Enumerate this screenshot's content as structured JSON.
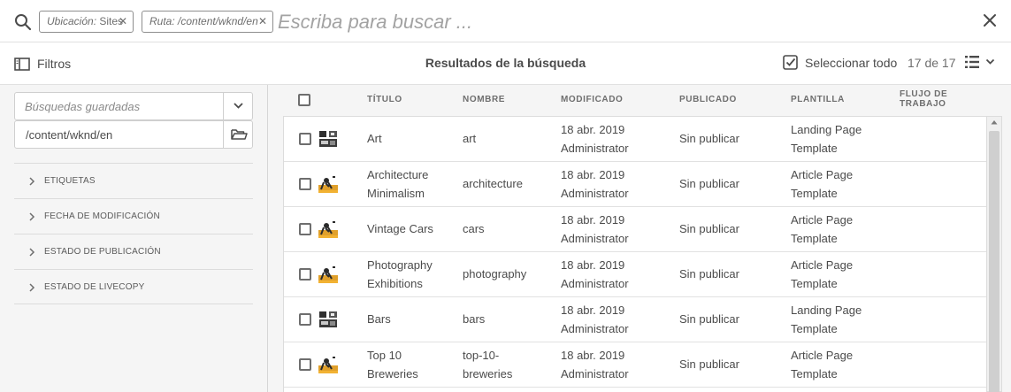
{
  "search": {
    "tags": [
      {
        "key": "Ubicación:",
        "value": " Sites"
      },
      {
        "key": "Ruta:",
        "value": " /content/wknd/en"
      }
    ],
    "placeholder": "Escriba para buscar ..."
  },
  "actionbar": {
    "filters_label": "Filtros",
    "title": "Resultados de la búsqueda",
    "select_all_label": "Seleccionar todo",
    "count": "17 de 17"
  },
  "rail": {
    "saved_searches_placeholder": "Búsquedas guardadas",
    "path_value": "/content/wknd/en",
    "sections": [
      "ETIQUETAS",
      "FECHA DE MODIFICACIÓN",
      "ESTADO DE PUBLICACIÓN",
      "ESTADO DE LIVECOPY"
    ]
  },
  "table": {
    "headers": {
      "title": "TÍTULO",
      "name": "NOMBRE",
      "modified": "MODIFICADO",
      "published": "PUBLICADO",
      "template": "PLANTILLA",
      "workflow_1": "FLUJO DE",
      "workflow_2": "TRABAJO"
    },
    "rows": [
      {
        "title_1": "Art",
        "title_2": "",
        "name_1": "art",
        "name_2": "",
        "date": "18 abr. 2019",
        "user": "Administrator",
        "published": "Sin publicar",
        "template_1": "Landing Page",
        "template_2": "Template",
        "thumb": "landing-thumb-icon"
      },
      {
        "title_1": "Architecture",
        "title_2": "Minimalism",
        "name_1": "architecture",
        "name_2": "",
        "date": "18 abr. 2019",
        "user": "Administrator",
        "published": "Sin publicar",
        "template_1": "Article Page",
        "template_2": "Template",
        "thumb": "article-thumb-icon"
      },
      {
        "title_1": "Vintage Cars",
        "title_2": "",
        "name_1": "cars",
        "name_2": "",
        "date": "18 abr. 2019",
        "user": "Administrator",
        "published": "Sin publicar",
        "template_1": "Article Page",
        "template_2": "Template",
        "thumb": "article-thumb-icon"
      },
      {
        "title_1": "Photography",
        "title_2": "Exhibitions",
        "name_1": "photography",
        "name_2": "",
        "date": "18 abr. 2019",
        "user": "Administrator",
        "published": "Sin publicar",
        "template_1": "Article Page",
        "template_2": "Template",
        "thumb": "article-thumb-icon"
      },
      {
        "title_1": "Bars",
        "title_2": "",
        "name_1": "bars",
        "name_2": "",
        "date": "18 abr. 2019",
        "user": "Administrator",
        "published": "Sin publicar",
        "template_1": "Landing Page",
        "template_2": "Template",
        "thumb": "landing-thumb-icon"
      },
      {
        "title_1": "Top 10",
        "title_2": "Breweries",
        "name_1": "top-10-",
        "name_2": "breweries",
        "date": "18 abr. 2019",
        "user": "Administrator",
        "published": "Sin publicar",
        "template_1": "Article Page",
        "template_2": "Template",
        "thumb": "article-thumb-icon"
      }
    ]
  }
}
